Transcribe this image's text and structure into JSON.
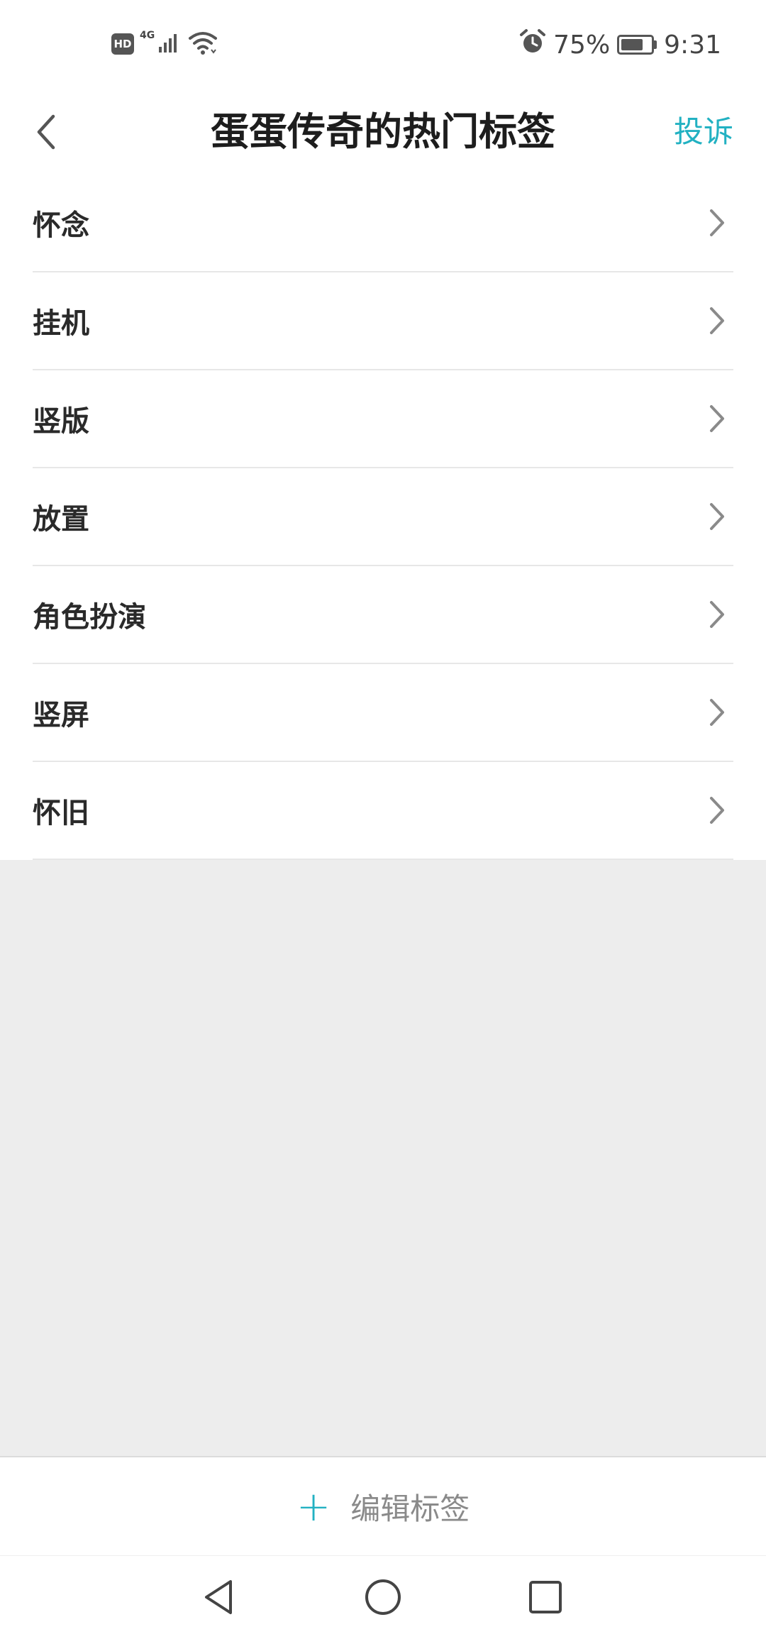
{
  "status_bar": {
    "hd": "HD",
    "network": "4G",
    "battery_percent_text": "75%",
    "battery_level": 0.75,
    "time": "9:31",
    "icons": [
      "signal-icon",
      "wifi-icon",
      "alarm-icon",
      "battery-icon"
    ]
  },
  "header": {
    "title": "蛋蛋传奇的热门标签",
    "report_label": "投诉"
  },
  "tags": [
    {
      "label": "怀念"
    },
    {
      "label": "挂机"
    },
    {
      "label": "竖版"
    },
    {
      "label": "放置"
    },
    {
      "label": "角色扮演"
    },
    {
      "label": "竖屏"
    },
    {
      "label": "怀旧"
    }
  ],
  "edit_bar": {
    "plus": "+",
    "label": "编辑标签"
  },
  "colors": {
    "accent": "#22b1c2",
    "background": "#ededed",
    "text": "#2a2a2a",
    "muted": "#8a8a8a"
  }
}
